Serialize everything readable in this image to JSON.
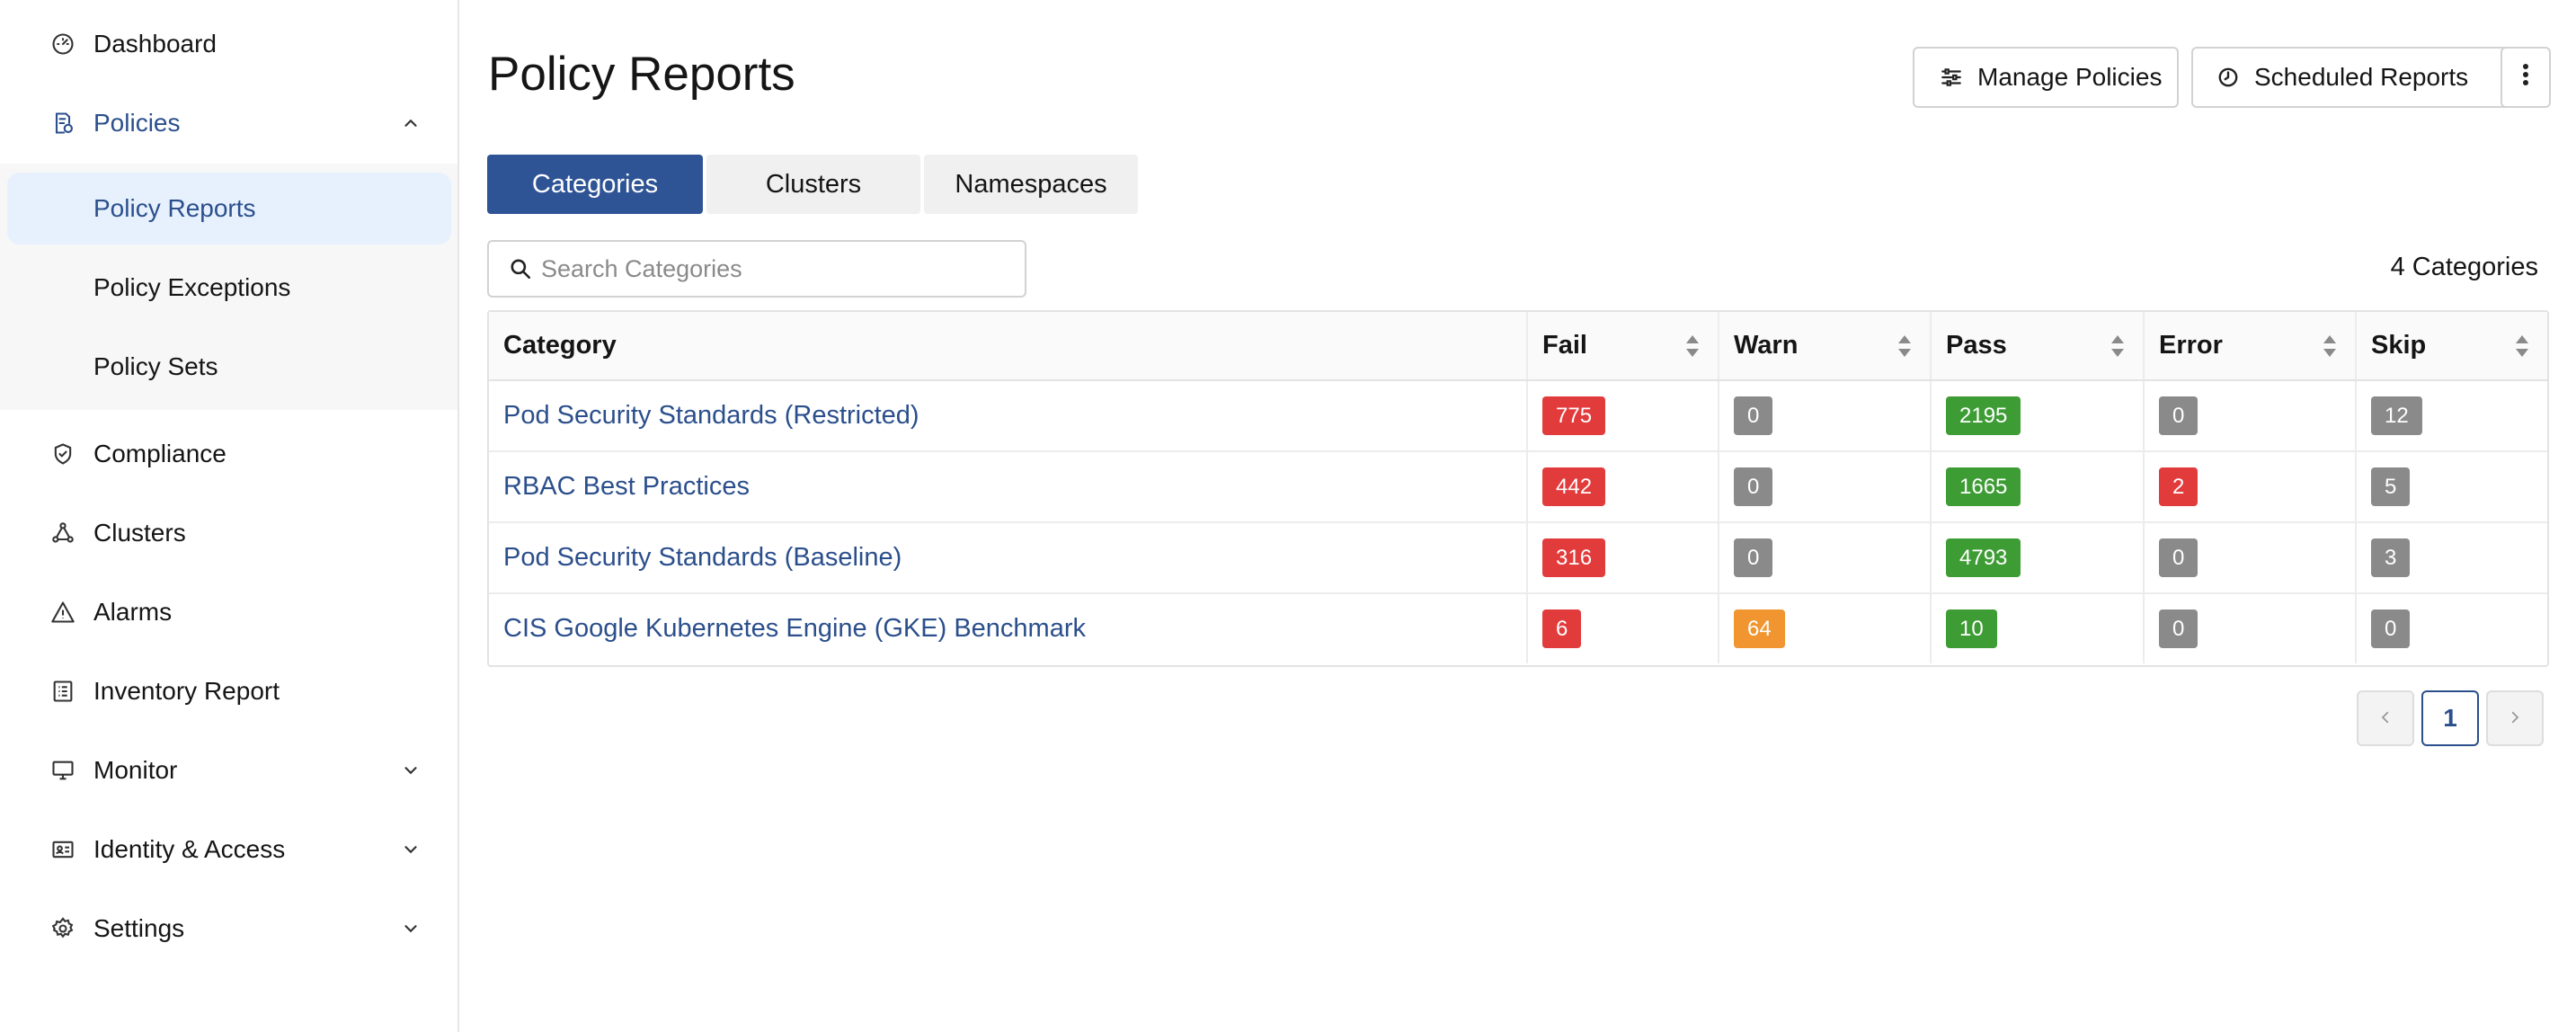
{
  "sidebar": {
    "items": [
      {
        "id": "dashboard",
        "label": "Dashboard",
        "icon": "gauge-icon"
      },
      {
        "id": "policies",
        "label": "Policies",
        "icon": "policy-document-icon",
        "expanded": true
      },
      {
        "id": "compliance",
        "label": "Compliance",
        "icon": "shield-check-icon"
      },
      {
        "id": "clusters",
        "label": "Clusters",
        "icon": "cluster-nodes-icon"
      },
      {
        "id": "alarms",
        "label": "Alarms",
        "icon": "warning-triangle-icon"
      },
      {
        "id": "inventory",
        "label": "Inventory Report",
        "icon": "list-report-icon"
      },
      {
        "id": "monitor",
        "label": "Monitor",
        "icon": "monitor-icon"
      },
      {
        "id": "identity",
        "label": "Identity & Access",
        "icon": "id-card-icon"
      },
      {
        "id": "settings",
        "label": "Settings",
        "icon": "gear-icon"
      }
    ],
    "policies_sub": [
      {
        "label": "Policy Reports",
        "active": true
      },
      {
        "label": "Policy Exceptions"
      },
      {
        "label": "Policy Sets"
      }
    ]
  },
  "header": {
    "title": "Policy Reports",
    "manage_label": "Manage Policies",
    "scheduled_label": "Scheduled Reports"
  },
  "tabs": [
    {
      "label": "Categories",
      "active": true
    },
    {
      "label": "Clusters"
    },
    {
      "label": "Namespaces"
    }
  ],
  "search": {
    "placeholder": "Search Categories",
    "value": ""
  },
  "count_label": "4 Categories",
  "table": {
    "columns": [
      "Category",
      "Fail",
      "Warn",
      "Pass",
      "Error",
      "Skip"
    ],
    "rows": [
      {
        "category": "Pod Security Standards (Restricted)",
        "fail": "775",
        "warn": "0",
        "pass": "2195",
        "error": "0",
        "skip": "12"
      },
      {
        "category": "RBAC Best Practices",
        "fail": "442",
        "warn": "0",
        "pass": "1665",
        "error": "2",
        "skip": "5"
      },
      {
        "category": "Pod Security Standards (Baseline)",
        "fail": "316",
        "warn": "0",
        "pass": "4793",
        "error": "0",
        "skip": "3"
      },
      {
        "category": "CIS Google Kubernetes Engine (GKE) Benchmark",
        "fail": "6",
        "warn": "64",
        "pass": "10",
        "error": "0",
        "skip": "0"
      }
    ]
  },
  "pagination": {
    "current_page": "1"
  },
  "colors": {
    "brand": "#2f5496",
    "link": "#2b4f8c",
    "fail": "#e23b3b",
    "warn": "#f0952f",
    "pass": "#3e9c35",
    "neutral": "#8a8a8a"
  }
}
